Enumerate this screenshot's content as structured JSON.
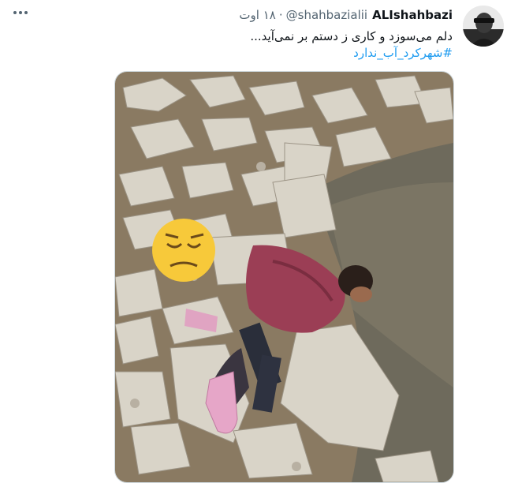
{
  "tweet": {
    "author_name": "ALIshahbazi",
    "author_handle": "@shahbazialii",
    "separator": "·",
    "time": "۱۸ اوت",
    "text": "دلم می‌سوزد و کاری ز دستم بر نمی‌آید...",
    "hashtag": "#شهرکرد_آب_ندارد"
  },
  "icons": {
    "more": "more-horizontal-icon",
    "emoji": "pensive-face-emoji"
  },
  "colors": {
    "link": "#1d9bf0",
    "text": "#0f1419",
    "secondary": "#536471"
  }
}
